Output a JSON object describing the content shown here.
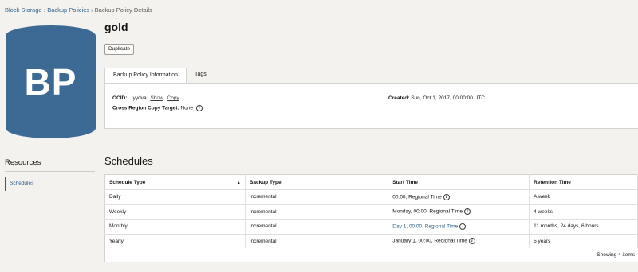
{
  "breadcrumb": {
    "items": [
      "Block Storage",
      "Backup Policies",
      "Backup Policy Details"
    ],
    "separator": "›"
  },
  "avatar": {
    "text": "BP"
  },
  "page": {
    "title": "gold",
    "duplicate_label": "Duplicate"
  },
  "tabs": [
    {
      "label": "Backup Policy Information",
      "active": true
    },
    {
      "label": "Tags",
      "active": false
    }
  ],
  "info": {
    "ocid_label": "OCID:",
    "ocid_value": "...yydva",
    "show_label": "Show",
    "copy_label": "Copy",
    "created_label": "Created:",
    "created_value": "Sun, Oct 1, 2017, 00:00:00 UTC",
    "cross_region_label": "Cross Region Copy Target:",
    "cross_region_value": "None"
  },
  "resources": {
    "title": "Resources",
    "items": [
      {
        "label": "Schedules"
      }
    ]
  },
  "schedules": {
    "title": "Schedules",
    "columns": [
      "Schedule Type",
      "Backup Type",
      "Start Time",
      "Retention Time"
    ],
    "rows": [
      {
        "schedule_type": "Daily",
        "backup_type": "Incremental",
        "start_time": "00:00, Regional Time",
        "retention": "A week"
      },
      {
        "schedule_type": "Weekly",
        "backup_type": "Incremental",
        "start_time": "Monday, 00:00, Regional Time",
        "retention": "4 weeks"
      },
      {
        "schedule_type": "Monthly",
        "backup_type": "Incremental",
        "start_time": "Day 1, 00:00, Regional Time",
        "retention": "11 months, 24 days, 6 hours"
      },
      {
        "schedule_type": "Yearly",
        "backup_type": "Incremental",
        "start_time": "January 1, 00:00, Regional Time",
        "retention": "5 years"
      }
    ],
    "footer": "Showing 4 items"
  },
  "colors": {
    "link": "#2e5f8a",
    "avatar_bg": "#3d6995",
    "page_bg": "#f3f2ef"
  },
  "icons": {
    "info": "info-circle-icon",
    "sort": "sort-ascending-icon"
  }
}
